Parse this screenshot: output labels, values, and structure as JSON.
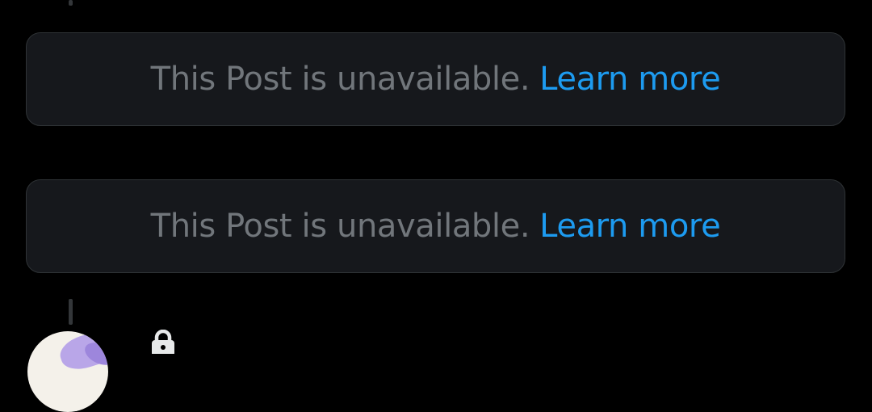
{
  "timeline": {
    "posts": [
      {
        "notice": "This Post is unavailable.",
        "link": "Learn more"
      },
      {
        "notice": "This Post is unavailable.",
        "link": "Learn more"
      }
    ],
    "next_post": {
      "avatar_icon": "user-avatar",
      "protected_icon": "lock-icon"
    }
  },
  "colors": {
    "background": "#000000",
    "card_background": "#16181c",
    "card_border": "#2f3336",
    "muted_text": "#71767b",
    "link": "#1d9bf0"
  }
}
